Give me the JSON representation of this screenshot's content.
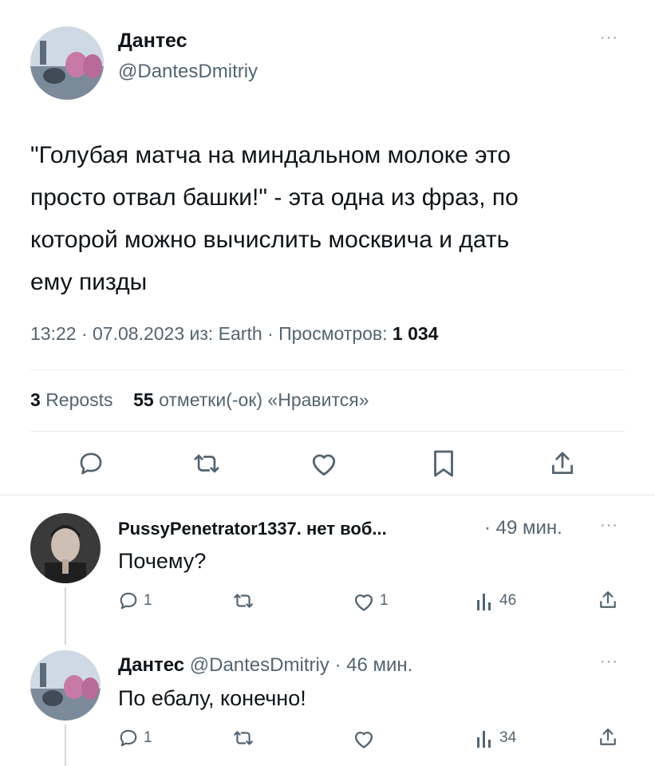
{
  "tweet": {
    "author_name": "Дантес",
    "author_handle": "@DantesDmitriy",
    "more_icon": "more-dots-icon",
    "text_lines": [
      "\"Голубая матча на миндальном молоке это",
      "просто отвал башки!\" - эта одна из фраз, по",
      "которой можно вычислить москвича и дать",
      "ему пизды"
    ],
    "meta_time": "13:22 · 07.08.2023 из: Earth · Просмотров:",
    "meta_views": "1 034",
    "reposts_count": "3",
    "reposts_label": "Reposts",
    "likes_count": "55",
    "likes_label": "отметки(-ок) «Нравится»",
    "actions": [
      "reply-icon",
      "repost-icon",
      "like-icon",
      "bookmark-icon",
      "share-icon"
    ]
  },
  "replies": [
    {
      "author_name": "PussyPenetrator1337. нет воб...",
      "time": "· 49 мин.",
      "text": "Почему?",
      "reply_count": "1",
      "like_count": "1",
      "views_count": "46"
    },
    {
      "author_name": "Дантес",
      "author_handle": "@DantesDmitriy",
      "time": "· 46 мин.",
      "text": "По ебалу, конечно!",
      "reply_count": "1",
      "views_count": "34"
    }
  ],
  "colors": {
    "text": "#0f1419",
    "secondary": "#536471",
    "icon": "#536471",
    "divider": "#e6ecf0"
  }
}
